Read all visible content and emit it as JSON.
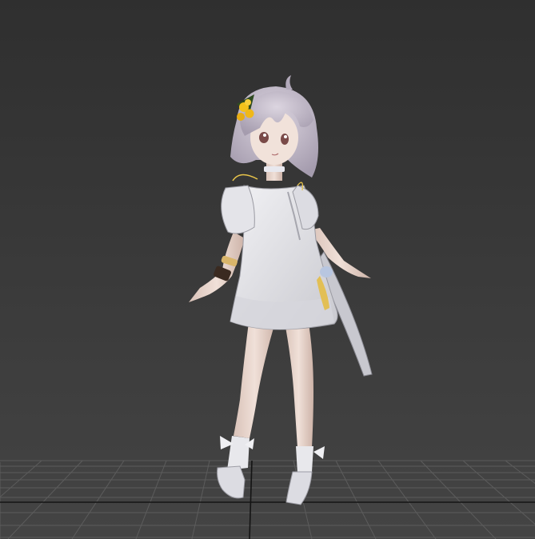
{
  "viewport": {
    "view": "perspective",
    "shading": "realistic",
    "background_color": "#3a3a3a",
    "grid_color": "#5a5a5a",
    "grid_axis_color": "#1a1a1a",
    "grid_visible": true
  },
  "scene": {
    "model": "anime-girl-character",
    "accent_colors": {
      "hair": "#cbc3d1",
      "dress": "#e6e6ea",
      "skin": "#ead8d0",
      "flower": "#f2c21b",
      "bracelet": "#d9b56a",
      "wristband": "#3a2a20",
      "selection_halo": "#e8c44a"
    }
  }
}
